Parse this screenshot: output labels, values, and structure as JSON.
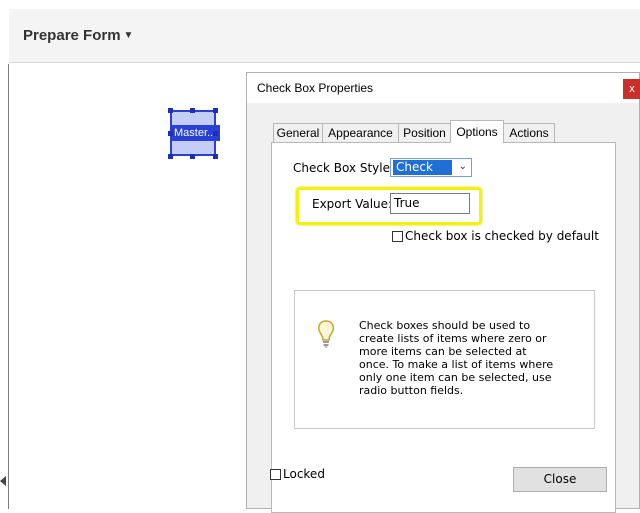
{
  "toolbar": {
    "title": "Prepare Form"
  },
  "canvas": {
    "field_label": "Master.."
  },
  "dialog": {
    "title": "Check Box Properties",
    "close_x": "x",
    "tabs": [
      {
        "label": "General"
      },
      {
        "label": "Appearance"
      },
      {
        "label": "Position"
      },
      {
        "label": "Options"
      },
      {
        "label": "Actions"
      }
    ],
    "active_tab": "Options",
    "check_box_style_label": "Check Box Style:",
    "check_box_style_value": "Check",
    "export_value_label": "Export Value:",
    "export_value": "True",
    "checked_by_default_label": "Check box is checked by default",
    "checked_by_default": false,
    "info_lines": [
      "Check boxes should be used to",
      "create lists of items where zero or",
      "more items can be selected at",
      "once. To make a list of items where",
      "only one item can be selected, use",
      "radio button fields."
    ],
    "locked_label": "Locked",
    "locked": false,
    "close_button": "Close"
  },
  "colors": {
    "highlight": "#f4f20a",
    "selection": "#2a3fd6",
    "select_highlight": "#1f6fd6",
    "close_red": "#c9302c"
  },
  "icons": [
    "caret-down-icon",
    "close-icon",
    "chevron-down-icon",
    "lightbulb-icon",
    "arrow-left-icon"
  ]
}
